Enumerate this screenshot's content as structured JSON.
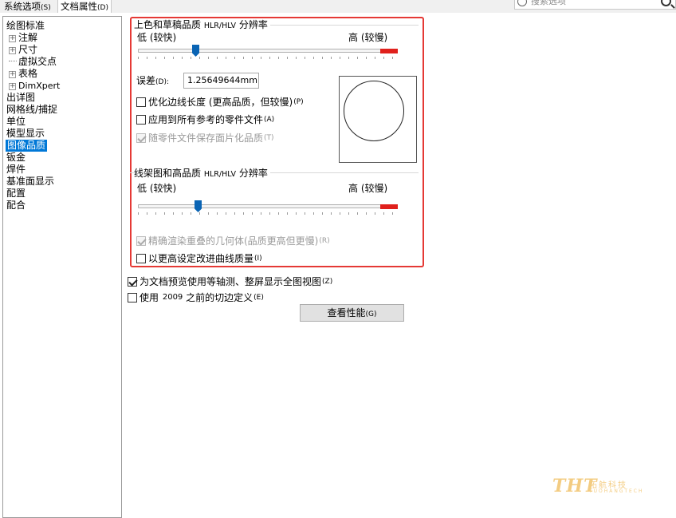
{
  "tabs": {
    "system": {
      "label": "系统选项",
      "key": "(S)"
    },
    "document": {
      "label": "文档属性",
      "key": "(D)"
    }
  },
  "search": {
    "placeholder": "搜索选项"
  },
  "tree": {
    "items": [
      {
        "label": "绘图标准"
      },
      {
        "label": "注解"
      },
      {
        "label": "尺寸"
      },
      {
        "label": "虚拟交点"
      },
      {
        "label": "表格"
      },
      {
        "label": "DimXpert"
      },
      {
        "label": "出详图"
      },
      {
        "label": "网格线/捕捉"
      },
      {
        "label": "单位"
      },
      {
        "label": "模型显示"
      },
      {
        "label": "图像品质"
      },
      {
        "label": "钣金"
      },
      {
        "label": "焊件"
      },
      {
        "label": "基准面显示"
      },
      {
        "label": "配置"
      },
      {
        "label": "配合"
      }
    ]
  },
  "shaded": {
    "title": "上色和草稿品质",
    "title_small": "HLR/HLV",
    "title_suffix": "分辨率",
    "low": "低 (较快)",
    "high": "高 (较慢)",
    "slider_value": 0.22,
    "deviation_label": "误差",
    "deviation_key": "(D):",
    "deviation_value": "1.25649644mm",
    "opt_edge": {
      "label": "优化边线长度 (更高品质，但较慢)",
      "key": "(P)",
      "checked": false
    },
    "opt_apply": {
      "label": "应用到所有参考的零件文件",
      "key": "(A)",
      "checked": false
    },
    "opt_save": {
      "label": "随零件文件保存面片化品质",
      "key": "(T)",
      "checked": true,
      "disabled": true
    }
  },
  "wireframe": {
    "title": "线架图和高品质",
    "title_small": "HLR/HLV",
    "title_suffix": "分辨率",
    "low": "低 (较快)",
    "high": "高 (较慢)",
    "slider_value": 0.23,
    "opt_precise": {
      "label": "精确渲染重叠的几何体(品质更高但更慢)",
      "key": "(R)",
      "checked": true,
      "disabled": true
    },
    "opt_curve": {
      "label": "以更高设定改进曲线质量",
      "key": "(I)",
      "checked": false
    }
  },
  "misc": {
    "opt_iso": {
      "label": "为文档预览使用等轴测、整屏显示全图视图",
      "key": "(Z)",
      "checked": true
    },
    "opt_tangent": {
      "label": "使用",
      "num": "2009",
      "label2": "之前的切边定义",
      "key": "(E)",
      "checked": false
    },
    "perf_button": {
      "label": "查看性能",
      "key": "(G)"
    }
  },
  "watermark": {
    "letters": "THT",
    "cn": "拓航科技",
    "en": "TUOHANGTECH"
  },
  "colors": {
    "accent": "#0078d7",
    "highlight_border": "#e53935",
    "slider_red": "#e0201c",
    "thumb": "#0a64b4"
  }
}
